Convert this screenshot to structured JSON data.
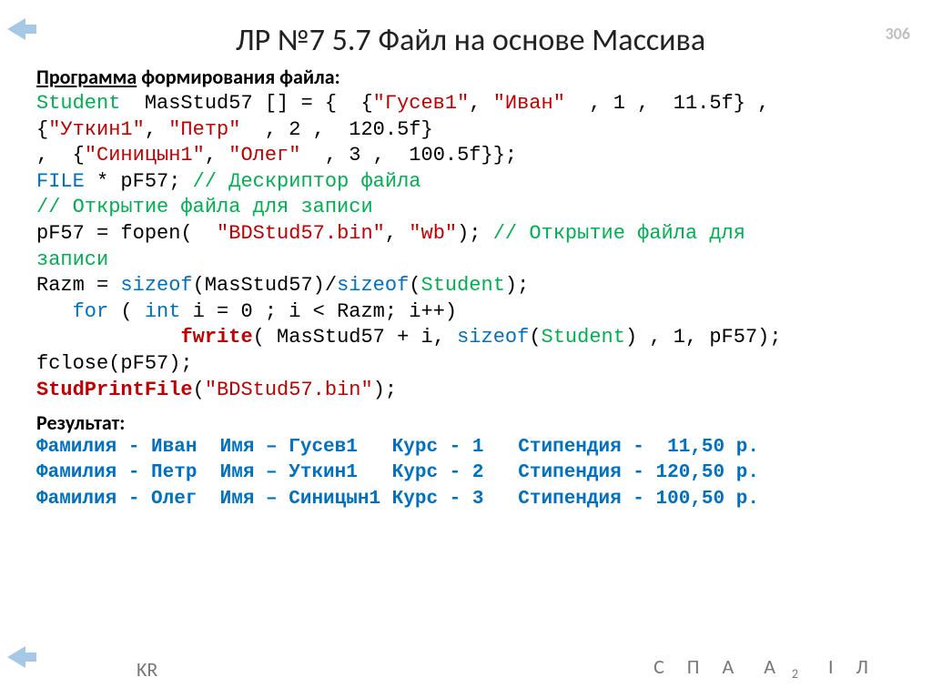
{
  "page_number": "306",
  "title": "ЛР №7 5.7 Файл на основе Массива",
  "program_label_underlined": "Программа",
  "program_label_rest": " формирования файла:",
  "code": {
    "l1a": "Student",
    "l1b": "  MasStud57 [] = {  {",
    "l1c": "\"Гусев1\"",
    "l1d": ", ",
    "l1e": "\"Иван\"",
    "l1f": "  , 1 ,  11.5f} ,",
    "l2a": "{",
    "l2b": "\"Уткин1\"",
    "l2c": ", ",
    "l2d": "\"Петр\"",
    "l2e": "  , 2 ,  120.5f}",
    "l3a": ",  {",
    "l3b": "\"Синицын1\"",
    "l3c": ", ",
    "l3d": "\"Олег\"",
    "l3e": "  , 3 ,  100.5f}};",
    "l4a": "FILE",
    "l4b": " * pF57; ",
    "l4c": "// Дескриптор файла",
    "l5": "// Открытие файла для записи",
    "l6a": "pF57 = fopen(  ",
    "l6b": "\"BDStud57.bin\"",
    "l6c": ", ",
    "l6d": "\"wb\"",
    "l6e": "); ",
    "l6f": "// Открытие файла для",
    "l7": "записи",
    "l8a": "Razm = ",
    "l8b": "sizeof",
    "l8c": "(MasStud57)/",
    "l8d": "sizeof",
    "l8e": "(",
    "l8f": "Student",
    "l8g": ");",
    "l9a": "   for",
    "l9b": " ( ",
    "l9c": "int",
    "l9d": " i = 0 ; i < Razm; i++)",
    "l10a": "            ",
    "l10b": "fwrite",
    "l10c": "( MasStud57 + i, ",
    "l10d": "sizeof",
    "l10e": "(",
    "l10f": "Student",
    "l10g": ") , 1, pF57);",
    "l11": "fclose(pF57);",
    "l12a": "StudPrintFile",
    "l12b": "(",
    "l12c": "\"BDStud57.bin\"",
    "l12d": ");"
  },
  "result_label": "Результат:",
  "results": [
    "Фамилия - Иван  Имя – Гусев1   Курс - 1   Стипендия -  11,50 р.",
    "Фамилия - Петр  Имя – Уткин1   Курс - 2   Стипендия - 120,50 р.",
    "Фамилия - Олег  Имя – Синицын1 Курс - 3   Стипендия - 100,50 р."
  ],
  "footer": {
    "kr": "KR",
    "c": "С",
    "p": "П",
    "a": "А",
    "a2": "А",
    "a2sub": "2",
    "i": "I",
    "l": "Л"
  }
}
